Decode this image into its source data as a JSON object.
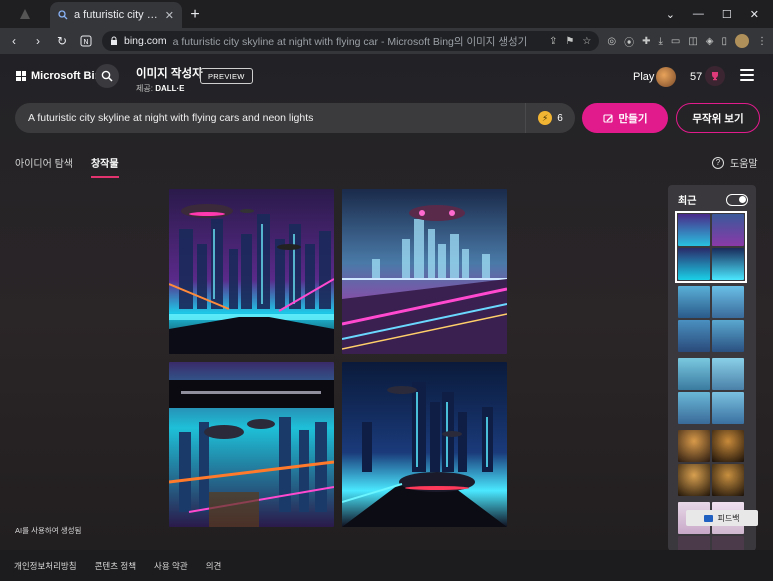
{
  "browser": {
    "tab_title": "a futuristic city skyline at ni",
    "new_tab": "+",
    "window_controls": [
      "⌄",
      "—",
      "☐",
      "✕"
    ],
    "url_host": "bing.com",
    "url_rest": "a futuristic city skyline at night with flying car - Microsoft Bing의 이미지 생성기"
  },
  "header": {
    "logo_text": "Microsoft Bing",
    "product_title": "이미지 작성자",
    "powered_prefix": "제공:",
    "powered_by": "DALL·E",
    "preview_badge": "PREVIEW",
    "play_label": "Play",
    "points": "57"
  },
  "prompt": {
    "value": "A futuristic city skyline at night with flying cars and neon lights",
    "boosts": "6",
    "create_label": "만들기",
    "surprise_label": "무작위 보기"
  },
  "tabs": [
    {
      "label": "아이디어 탐색",
      "active": false
    },
    {
      "label": "창작물",
      "active": true
    }
  ],
  "help_label": "도움말",
  "generated_note": "AI를 사용하여 생성됨",
  "recent": {
    "title": "최근"
  },
  "footer": {
    "links": [
      "개인정보처리방침",
      "콘텐츠 정책",
      "사용 약관",
      "의견"
    ],
    "feedback": "피드백"
  },
  "colors": {
    "accent_pink": "#e21b8c",
    "boost_gold": "#f2b533"
  }
}
